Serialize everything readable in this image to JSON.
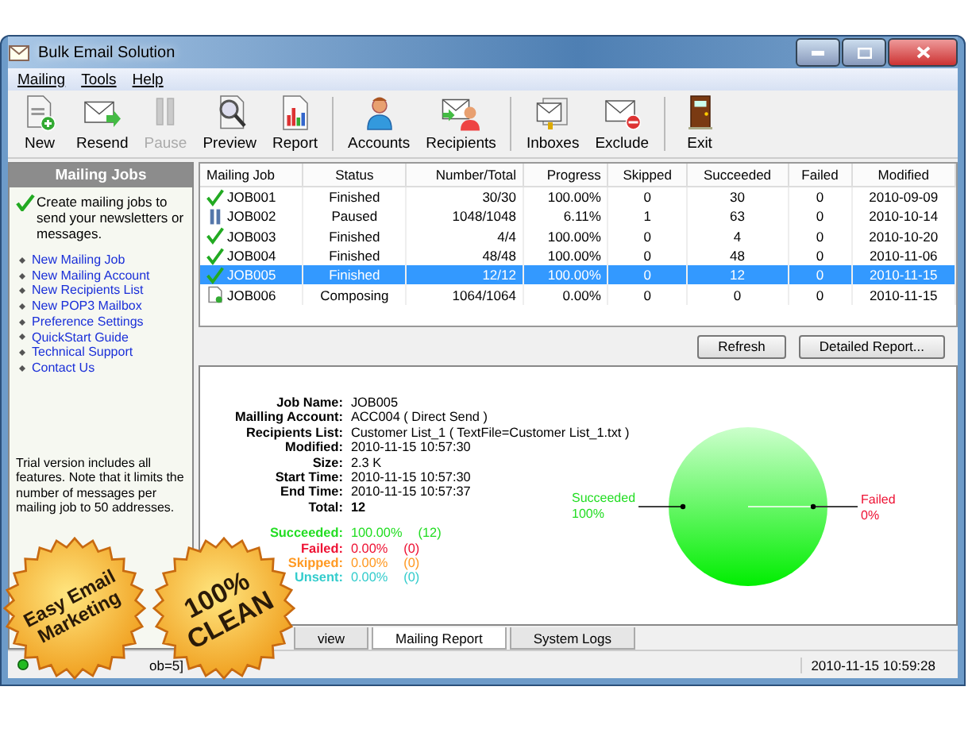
{
  "window": {
    "title": "Bulk Email Solution"
  },
  "menu": [
    {
      "label": "Mailing"
    },
    {
      "label": "Tools"
    },
    {
      "label": "Help"
    }
  ],
  "toolbar": [
    {
      "label": "New",
      "disabled": false
    },
    {
      "label": "Resend",
      "disabled": false
    },
    {
      "label": "Pause",
      "disabled": true
    },
    {
      "label": "Preview",
      "disabled": false
    },
    {
      "label": "Report",
      "disabled": false
    },
    {
      "label": "Accounts",
      "disabled": false
    },
    {
      "label": "Recipients",
      "disabled": false
    },
    {
      "label": "Inboxes",
      "disabled": false
    },
    {
      "label": "Exclude",
      "disabled": false
    },
    {
      "label": "Exit",
      "disabled": false
    }
  ],
  "sidebar": {
    "title": "Mailing Jobs",
    "intro": "Create mailing jobs to send your newsletters or messages.",
    "links": [
      "New Mailing Job",
      "New Mailing Account",
      "New Recipients List",
      "New POP3 Mailbox",
      "Preference Settings",
      "QuickStart Guide",
      "Technical Support",
      "Contact Us"
    ],
    "note": "Trial version includes all features. Note that it limits the number of messages per mailing job to 50 addresses."
  },
  "table": {
    "columns": [
      "Mailing Job",
      "Status",
      "Number/Total",
      "Progress",
      "Skipped",
      "Succeeded",
      "Failed",
      "Modified"
    ],
    "rows": [
      {
        "kind": "done",
        "selected": false,
        "cells": [
          "JOB001",
          "Finished",
          "30/30",
          "100.00%",
          "0",
          "30",
          "0",
          "2010-09-09"
        ]
      },
      {
        "kind": "paused",
        "selected": false,
        "cells": [
          "JOB002",
          "Paused",
          "1048/1048",
          "6.11%",
          "1",
          "63",
          "0",
          "2010-10-14"
        ]
      },
      {
        "kind": "done",
        "selected": false,
        "cells": [
          "JOB003",
          "Finished",
          "4/4",
          "100.00%",
          "0",
          "4",
          "0",
          "2010-10-20"
        ]
      },
      {
        "kind": "done",
        "selected": false,
        "cells": [
          "JOB004",
          "Finished",
          "48/48",
          "100.00%",
          "0",
          "48",
          "0",
          "2010-11-06"
        ]
      },
      {
        "kind": "done",
        "selected": true,
        "cells": [
          "JOB005",
          "Finished",
          "12/12",
          "100.00%",
          "0",
          "12",
          "0",
          "2010-11-15"
        ]
      },
      {
        "kind": "draft",
        "selected": false,
        "cells": [
          "JOB006",
          "Composing",
          "1064/1064",
          "0.00%",
          "0",
          "0",
          "0",
          "2010-11-15"
        ]
      }
    ]
  },
  "buttons": [
    "Refresh",
    "Detailed Report..."
  ],
  "details": [
    {
      "label": "Job Name:",
      "value": "JOB005"
    },
    {
      "label": "Mailling Account:",
      "value": "ACC004 ( Direct Send )"
    },
    {
      "label": "Recipients List:",
      "value": "Customer List_1 ( TextFile=Customer List_1.txt )"
    },
    {
      "label": "Modified:",
      "value": "2010-11-15 10:57:30"
    },
    {
      "label": "Size:",
      "value": "2.3 K"
    },
    {
      "label": "Start Time:",
      "value": "2010-11-15 10:57:30"
    },
    {
      "label": "End Time:",
      "value": "2010-11-15 10:57:37"
    },
    {
      "label": "Total:",
      "value": "12"
    }
  ],
  "stats": [
    {
      "label": "Succeeded:",
      "percent": "100.00%",
      "count": "(12)",
      "color": "#22dd22"
    },
    {
      "label": "Failed:",
      "percent": "0.00%",
      "count": "(0)",
      "color": "#ee1133"
    },
    {
      "label": "Skipped:",
      "percent": "0.00%",
      "count": "(0)",
      "color": "#ff9922"
    },
    {
      "label": "Unsent:",
      "percent": "0.00%",
      "count": "(0)",
      "color": "#33cccc"
    }
  ],
  "chart_data": {
    "type": "pie",
    "categories": [
      "Succeeded",
      "Failed"
    ],
    "values": [
      100,
      0
    ],
    "value_labels": [
      "100%",
      "0%"
    ]
  },
  "tabs": [
    {
      "label": "view",
      "selected": false
    },
    {
      "label": "Mailing Report",
      "selected": true
    },
    {
      "label": "System Logs",
      "selected": false
    }
  ],
  "status_bar": {
    "text": "ob=5]",
    "time": "2010-11-15 10:59:28"
  },
  "stickers": [
    {
      "lines": [
        "Easy Email",
        "Marketing"
      ]
    },
    {
      "lines": [
        "100%",
        "CLEAN"
      ]
    }
  ]
}
